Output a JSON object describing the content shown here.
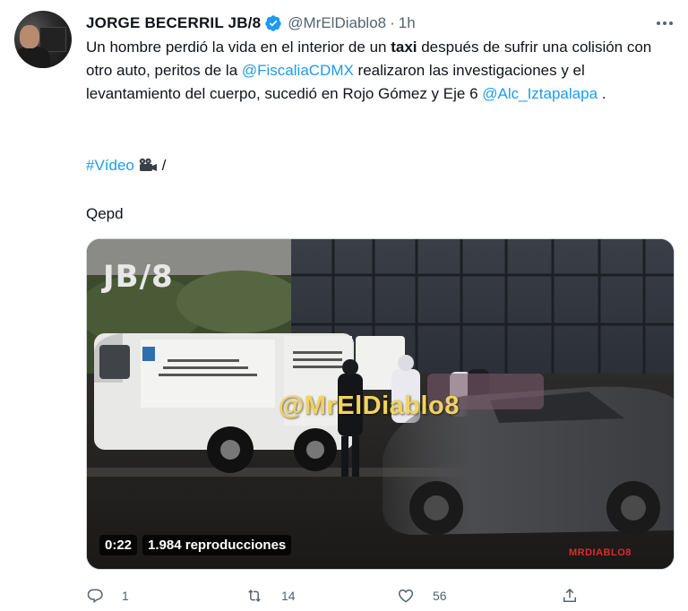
{
  "author": {
    "name": "JORGE BECERRIL JB/8",
    "handle": "@MrElDiablo8",
    "separator": "·",
    "time": "1h"
  },
  "tweet": {
    "text_parts": [
      "Un hombre perdió la vida en el interior de un ",
      "taxi",
      " después de sufrir una colisión con otro auto, peritos de la ",
      "@FiscaliaCDMX",
      " realizaron las investigaciones y el levantamiento del cuerpo, sucedió en Rojo Gómez y Eje 6 ",
      "@Alc_Iztapalapa",
      " ."
    ],
    "hashtag": "#Vídeo",
    "hashtag_suffix": " /",
    "closing": "Qepd"
  },
  "media": {
    "watermark_handle": "@MrElDiablo8",
    "overlay_logo": "JB/8",
    "corner_logo": "MRDIABLO8",
    "duration": "0:22",
    "views": "1.984 reproducciones"
  },
  "actions": {
    "replies": "1",
    "retweets": "14",
    "likes": "56"
  },
  "colors": {
    "link": "#1d9bf0",
    "muted": "#536471",
    "verified": "#1d9bf0",
    "watermark": "#f3d35c"
  },
  "icons": [
    "verified-icon",
    "more-icon",
    "camera-icon",
    "reply-icon",
    "retweet-icon",
    "like-icon",
    "share-icon"
  ]
}
